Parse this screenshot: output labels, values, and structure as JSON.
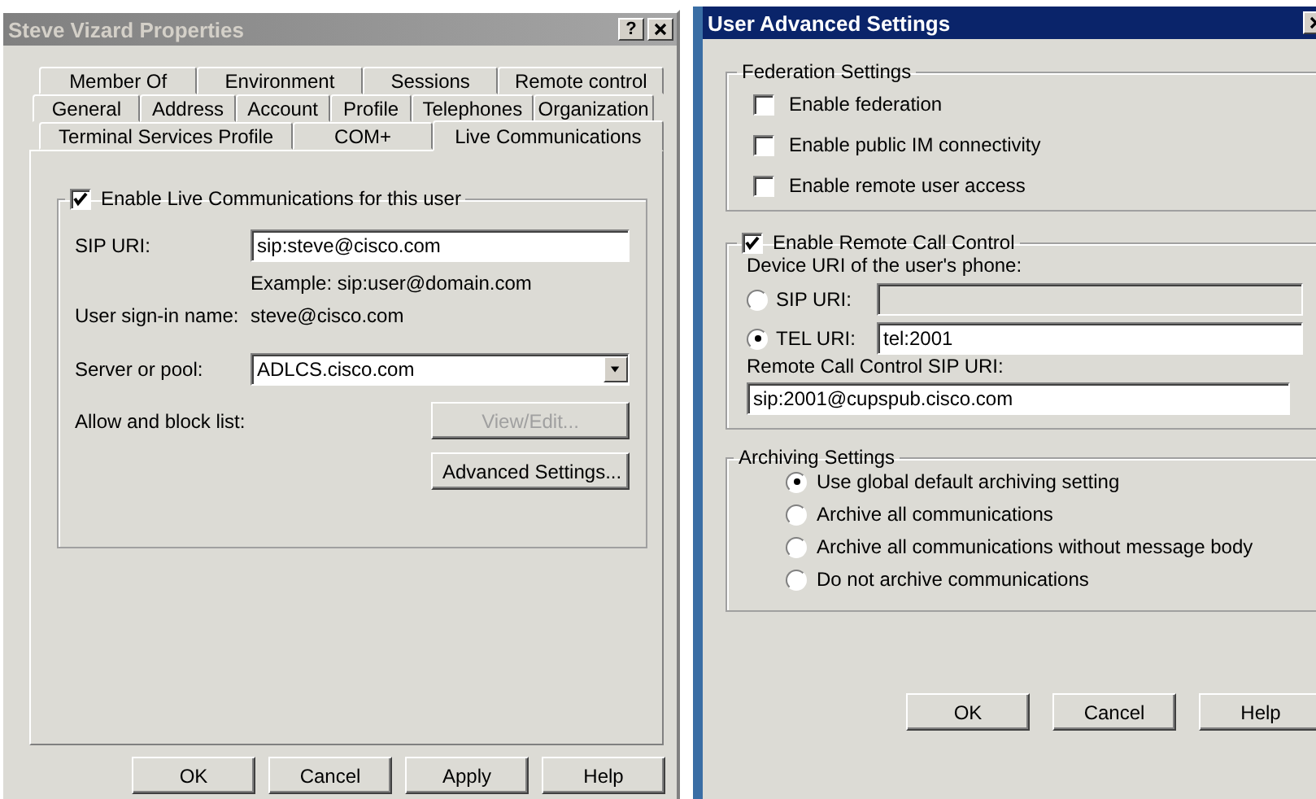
{
  "properties_dialog": {
    "title": "Steve Vizard Properties",
    "help_button": "?",
    "tab_rows": [
      {
        "tabs": [
          {
            "label": "Member Of",
            "selected": false
          },
          {
            "label": "Environment",
            "selected": false
          },
          {
            "label": "Sessions",
            "selected": false
          },
          {
            "label": "Remote control",
            "selected": false
          }
        ]
      },
      {
        "tabs": [
          {
            "label": "General",
            "selected": false
          },
          {
            "label": "Address",
            "selected": false
          },
          {
            "label": "Account",
            "selected": false
          },
          {
            "label": "Profile",
            "selected": false
          },
          {
            "label": "Telephones",
            "selected": false
          },
          {
            "label": "Organization",
            "selected": false
          }
        ]
      },
      {
        "tabs": [
          {
            "label": "Terminal Services Profile",
            "selected": false
          },
          {
            "label": "COM+",
            "selected": false
          },
          {
            "label": "Live Communications",
            "selected": true
          }
        ]
      }
    ],
    "enable_checkbox": {
      "label": "Enable Live Communications for this user",
      "checked": true
    },
    "sip_uri": {
      "label": "SIP URI:",
      "value": "sip:steve@cisco.com",
      "example": "Example: sip:user@domain.com"
    },
    "sign_in": {
      "label": "User sign-in name:",
      "value": "steve@cisco.com"
    },
    "server": {
      "label": "Server or pool:",
      "value": "ADLCS.cisco.com"
    },
    "allow_block": {
      "label": "Allow and block list:",
      "button": "View/Edit...",
      "disabled": true
    },
    "advanced_button": "Advanced Settings...",
    "buttons": [
      "OK",
      "Cancel",
      "Apply",
      "Help"
    ]
  },
  "advanced_dialog": {
    "title": "User Advanced Settings",
    "federation": {
      "title": "Federation Settings",
      "options": [
        {
          "label": "Enable federation",
          "checked": false
        },
        {
          "label": "Enable public IM connectivity",
          "checked": false
        },
        {
          "label": "Enable remote user access",
          "checked": false
        }
      ]
    },
    "remote_call_control": {
      "label": "Enable Remote Call Control",
      "checked": true,
      "device_label": "Device URI of the user's phone:",
      "device_options": [
        {
          "label": "SIP URI:",
          "selected": false,
          "disabled": true
        },
        {
          "label": "TEL URI:",
          "selected": true,
          "value": "tel:2001",
          "disabled": false
        }
      ],
      "sip_label": "Remote Call Control SIP URI:",
      "sip_value": "sip:2001@cupspub.cisco.com"
    },
    "archiving": {
      "title": "Archiving Settings",
      "options": [
        {
          "label": "Use global default archiving setting",
          "selected": true
        },
        {
          "label": "Archive all communications",
          "selected": false
        },
        {
          "label": "Archive all communications without message body",
          "selected": false
        },
        {
          "label": "Do not archive communications",
          "selected": false
        }
      ]
    },
    "buttons": [
      "OK",
      "Cancel",
      "Help"
    ]
  }
}
